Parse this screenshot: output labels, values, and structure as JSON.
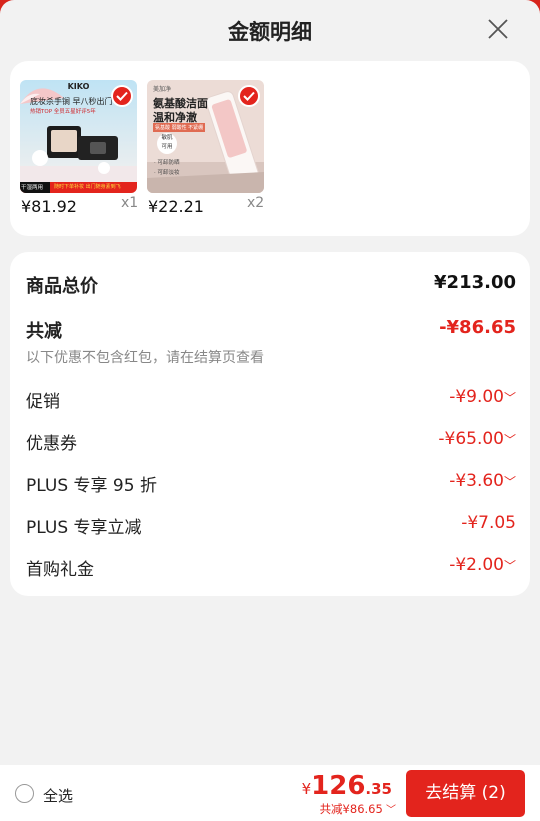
{
  "header": {
    "title": "金额明细"
  },
  "products": [
    {
      "price": "¥81.92",
      "qty": "x1",
      "image_text": {
        "brand": "KIKO",
        "headline": "底妆杀手锏 早八秒出门",
        "sub": "热销TOP 全员五星好评5年",
        "footer": "干湿两用",
        "footer2": "随时下单补妆 出门随身素到飞"
      }
    },
    {
      "price": "¥22.21",
      "qty": "x2",
      "image_text": {
        "brand": "美加净",
        "headline1": "氨基酸洁面",
        "headline2": "温和净澈",
        "tag": "氨基酸 弱酸性 不紧绷",
        "badge1": "敏肌",
        "badge2": "可用",
        "bullet1": "· 可卸防晒",
        "bullet2": "· 可卸淡妆"
      }
    }
  ],
  "summary": {
    "total_label": "商品总价",
    "total_value": "¥213.00",
    "reduce_label": "共减",
    "reduce_value": "-¥86.65",
    "note": "以下优惠不包含红包，请在结算页查看",
    "items": [
      {
        "label": "促销",
        "value": "-¥9.00",
        "has_chevron": true
      },
      {
        "label": "优惠券",
        "value": "-¥65.00",
        "has_chevron": true
      },
      {
        "label": "PLUS 专享 95 折",
        "value": "-¥3.60",
        "has_chevron": true
      },
      {
        "label": "PLUS 专享立减",
        "value": "-¥7.05",
        "has_chevron": false
      },
      {
        "label": "首购礼金",
        "value": "-¥2.00",
        "has_chevron": true
      }
    ]
  },
  "bottom": {
    "select_all": "全选",
    "currency": "¥",
    "total_int": "126",
    "total_dec": ".35",
    "reduce_text": "共减¥86.65",
    "checkout_label": "去结算 (2)"
  },
  "colors": {
    "accent": "#e3241d",
    "background": "#f2f2f2",
    "surface": "#ffffff"
  },
  "icons": {
    "close": "close-icon",
    "check": "check-icon",
    "chevron": "chevron-down-icon",
    "radio": "radio-unchecked-icon"
  }
}
